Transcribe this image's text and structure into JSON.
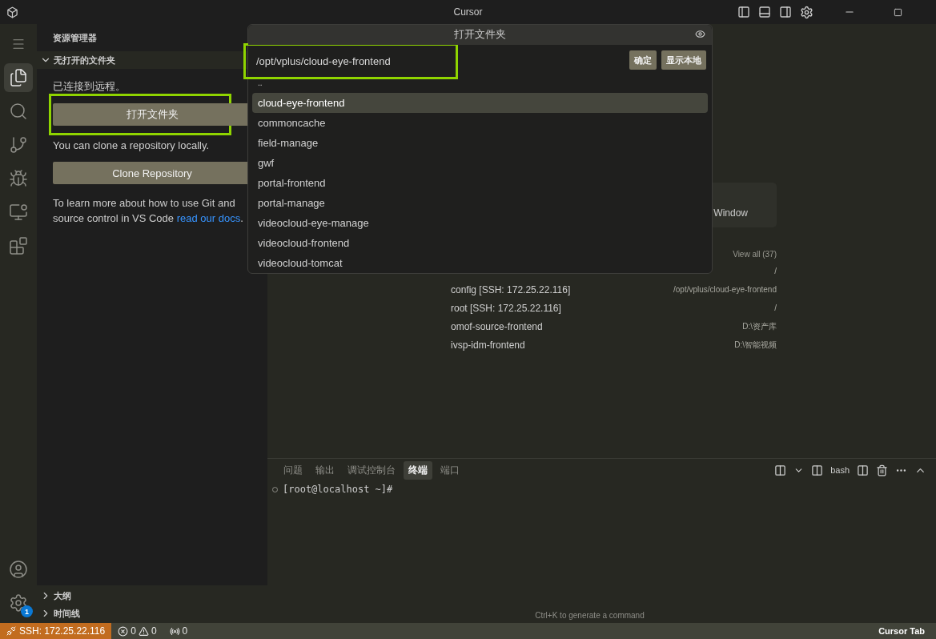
{
  "window": {
    "title": "Cursor"
  },
  "activity_bar": {
    "items": [
      {
        "kind": "menu",
        "selected": false
      },
      {
        "kind": "explorer",
        "selected": true
      },
      {
        "kind": "search",
        "selected": false
      },
      {
        "kind": "source-control",
        "selected": false
      },
      {
        "kind": "run",
        "selected": false
      },
      {
        "kind": "remote",
        "selected": false
      },
      {
        "kind": "extensions",
        "selected": false
      }
    ],
    "bottom": [
      {
        "kind": "account",
        "selected": false
      },
      {
        "kind": "settings",
        "selected": false,
        "badge": "1"
      }
    ]
  },
  "sidebar": {
    "title": "资源管理器",
    "section": {
      "title": "无打开的文件夹",
      "expanded": true
    },
    "status": "已连接到远程。",
    "open_folder_button": {
      "label": "打开文件夹",
      "highlighted": true
    },
    "clone_hint": "You can clone a repository locally.",
    "clone_button": "Clone Repository",
    "docs": {
      "text": "To learn more about how to use Git and source control in VS Code ",
      "link": "read our docs",
      "after": "."
    },
    "collapsed_sections": [
      {
        "title": "大纲",
        "expanded": false
      },
      {
        "title": "时间线",
        "expanded": false
      }
    ]
  },
  "dialog": {
    "title": "打开文件夹",
    "path": "/opt/vplus/cloud-eye-frontend",
    "path_highlighted": true,
    "buttons": [
      "确定",
      "显示本地"
    ],
    "items": [
      {
        "name": "..",
        "selected": false
      },
      {
        "name": "cloud-eye-frontend",
        "selected": true
      },
      {
        "name": "commoncache",
        "selected": false
      },
      {
        "name": "field-manage",
        "selected": false
      },
      {
        "name": "gwf",
        "selected": false
      },
      {
        "name": "portal-frontend",
        "selected": false
      },
      {
        "name": "portal-manage",
        "selected": false
      },
      {
        "name": "videocloud-eye-manage",
        "selected": false
      },
      {
        "name": "videocloud-frontend",
        "selected": false
      },
      {
        "name": "videocloud-tomcat",
        "selected": false
      }
    ]
  },
  "welcome": {
    "card_text": "Window",
    "view_all": "View all (37)",
    "recent": [
      {
        "path": "/"
      },
      {
        "name": "config [SSH: 172.25.22.116]",
        "path": "/opt/vplus/cloud-eye-frontend"
      },
      {
        "name": "root [SSH: 172.25.22.116]",
        "path": "/"
      },
      {
        "name": "omof-source-frontend",
        "path": "D:\\资产库"
      },
      {
        "name": "ivsp-idm-frontend",
        "path": "D:\\智能视频"
      }
    ]
  },
  "panel": {
    "tabs": [
      {
        "label": "问题",
        "selected": false
      },
      {
        "label": "输出",
        "selected": false
      },
      {
        "label": "调试控制台",
        "selected": false
      },
      {
        "label": "终端",
        "selected": true
      },
      {
        "label": "端口",
        "selected": false
      }
    ],
    "shell": "bash",
    "terminal_lines": [
      "[root@localhost ~]#"
    ],
    "hint": "Ctrl+K to generate a command"
  },
  "status_bar": {
    "remote": "SSH: 172.25.22.116",
    "errors": "0",
    "warnings": "0",
    "ports": "0",
    "right": "Cursor Tab"
  }
}
